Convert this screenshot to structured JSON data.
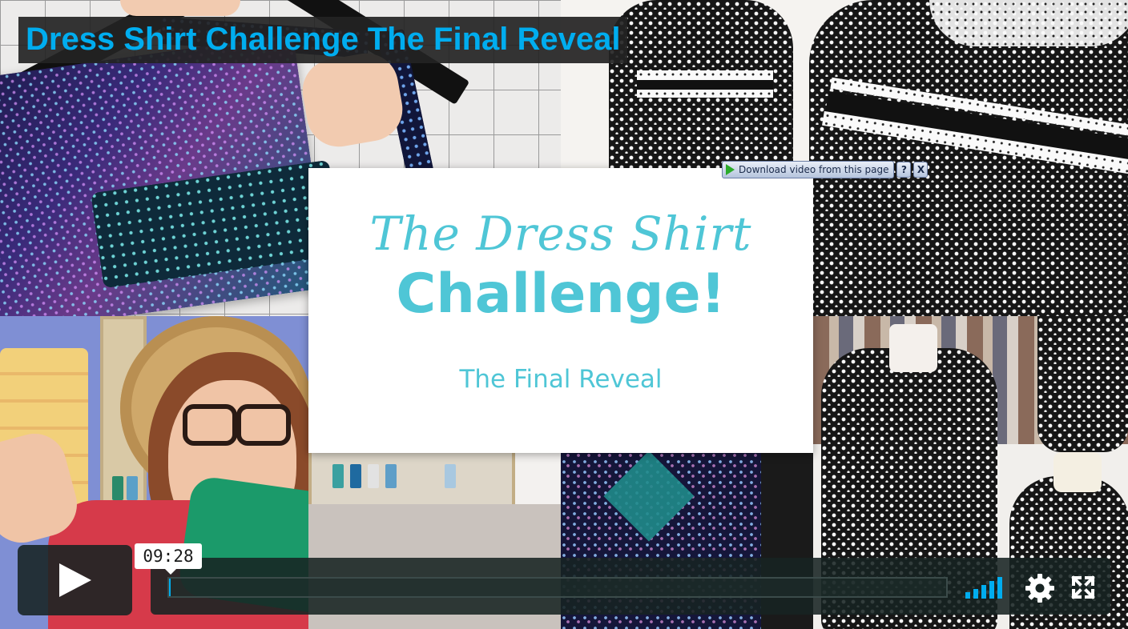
{
  "video": {
    "title": "Dress Shirt Challenge The Final Reveal"
  },
  "title_card": {
    "script_line": "The Dress Shirt",
    "main_line": "Challenge!",
    "subtitle": "The Final Reveal",
    "accent_color": "#4fc6d6"
  },
  "download_bar": {
    "label": "Download video from this page",
    "help_label": "?",
    "close_label": "X"
  },
  "player": {
    "time": "09:28",
    "progress_fraction": 0.002,
    "accent_color": "#00adef",
    "icons": [
      "play-icon",
      "volume-icon",
      "settings-icon",
      "fullscreen-icon"
    ]
  }
}
